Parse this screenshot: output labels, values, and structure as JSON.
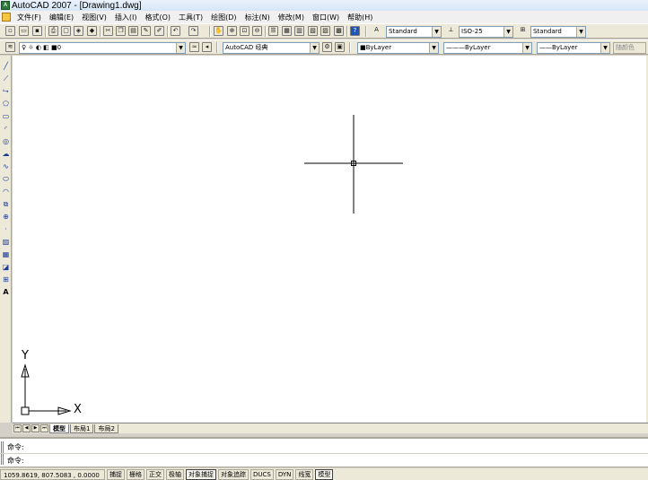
{
  "window": {
    "title": "AutoCAD 2007 - [Drawing1.dwg]"
  },
  "menu": [
    "文件(F)",
    "编辑(E)",
    "视图(V)",
    "插入(I)",
    "格式(O)",
    "工具(T)",
    "绘图(D)",
    "标注(N)",
    "修改(M)",
    "窗口(W)",
    "帮助(H)"
  ],
  "styles": {
    "text_style": "Standard",
    "dim_style": "ISO-25",
    "table_style": "Standard"
  },
  "layers": {
    "current_layer": "0",
    "workspace": "AutoCAD 经典"
  },
  "properties": {
    "color": "ByLayer",
    "linetype": "ByLayer",
    "lineweight": "ByLayer",
    "plot_style": "随颜色"
  },
  "ucs": {
    "x_label": "X",
    "y_label": "Y"
  },
  "tabs": [
    "模型",
    "布局1",
    "布局2"
  ],
  "command": {
    "line1": "命令:",
    "line2": "命令:"
  },
  "status": {
    "coords": "1059.8619,  807.5083 ,  0.0000",
    "toggles": [
      {
        "label": "捕捉",
        "on": false
      },
      {
        "label": "栅格",
        "on": false
      },
      {
        "label": "正交",
        "on": false
      },
      {
        "label": "极轴",
        "on": false
      },
      {
        "label": "对象捕捉",
        "on": true
      },
      {
        "label": "对象追踪",
        "on": false
      },
      {
        "label": "DUCS",
        "on": false
      },
      {
        "label": "DYN",
        "on": false
      },
      {
        "label": "线宽",
        "on": false
      },
      {
        "label": "模型",
        "on": true
      }
    ]
  }
}
